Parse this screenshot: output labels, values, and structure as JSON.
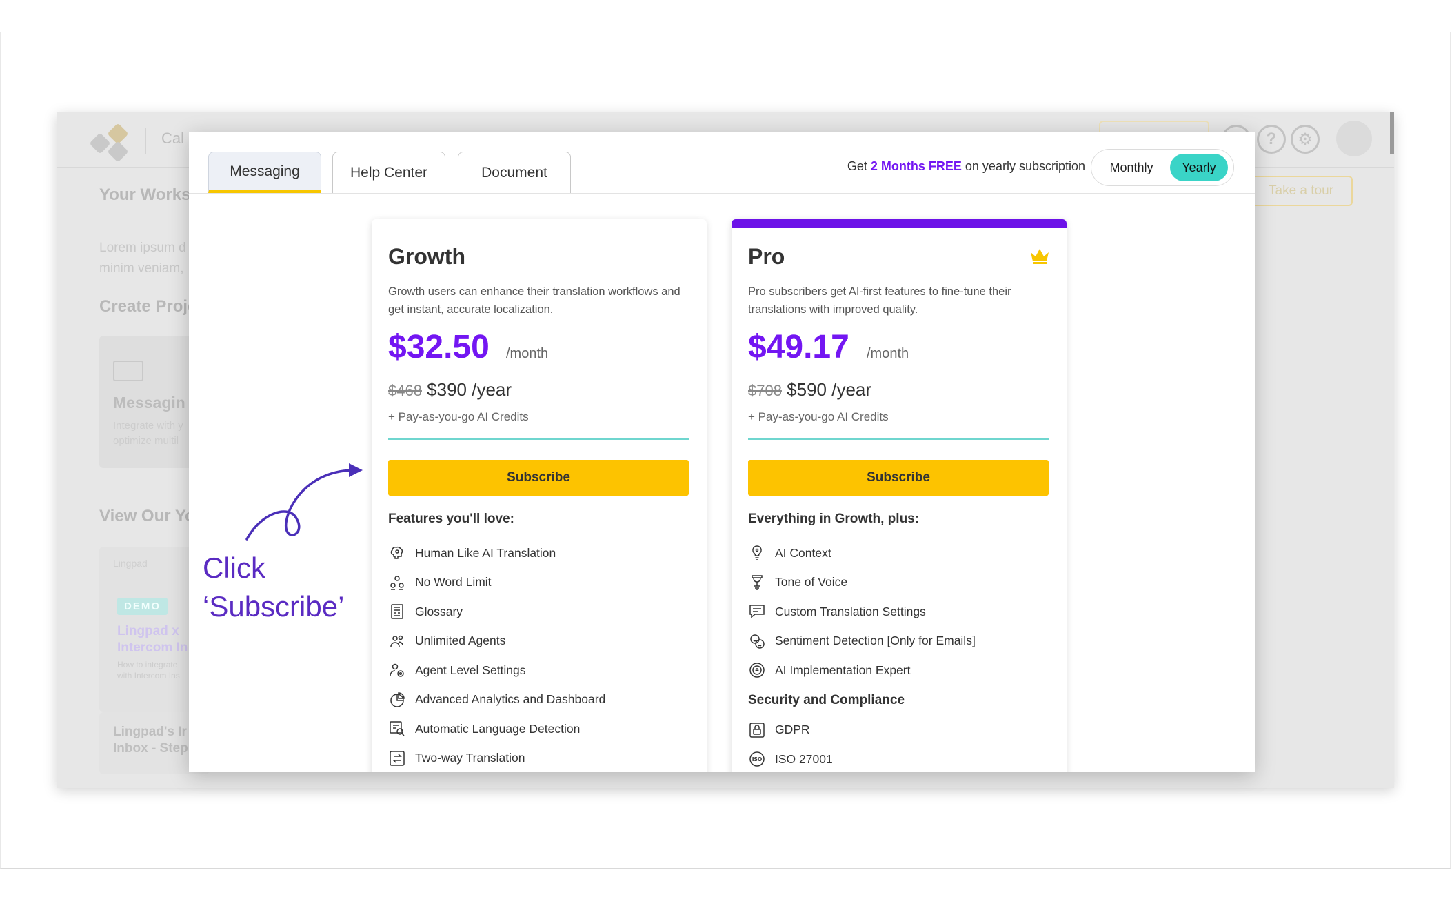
{
  "background_app": {
    "project_label": "Cal",
    "workspace_title": "Your Worksp",
    "intro_line1": "Lorem ipsum d",
    "intro_line2": "minim veniam,",
    "create_projects": "Create Proje",
    "messaging_card_title": "Messagin",
    "messaging_card_line1": "Integrate with y",
    "messaging_card_line2": "optimize multil",
    "view_our": "View Our Yo",
    "demo_brand": "Lingpad",
    "demo_badge": "DEMO",
    "demo_title1": "Lingpad x",
    "demo_title2": "Intercom In",
    "demo_sub1": "How to integrate",
    "demo_sub2": "with Intercom Ins",
    "inbox_line1": "Lingpad's Ir",
    "inbox_line2": "Inbox - Step",
    "take_tour": "Take a tour",
    "help_icon_glyph": "?"
  },
  "modal": {
    "tabs": [
      {
        "label": "Messaging",
        "active": true
      },
      {
        "label": "Help Center",
        "active": false
      },
      {
        "label": "Document",
        "active": false
      }
    ],
    "promo": {
      "prefix": "Get ",
      "highlight": "2 Months FREE",
      "suffix": " on yearly subscription"
    },
    "billing_toggle": {
      "options": [
        "Monthly",
        "Yearly"
      ],
      "selected": "Yearly"
    },
    "plans": [
      {
        "name": "Growth",
        "description": "Growth users can enhance their translation workflows and get instant, accurate localization.",
        "price": "$32.50",
        "per": "/month",
        "old_yearly": "$468",
        "yearly": " $390 /year",
        "credits": "+ Pay-as-you-go AI Credits",
        "cta": "Subscribe",
        "features_title": "Features you'll love:",
        "features": [
          {
            "label": "Human Like AI Translation",
            "icon": "brain-icon"
          },
          {
            "label": "No Word Limit",
            "icon": "infinity-people-icon"
          },
          {
            "label": "Glossary",
            "icon": "glossary-icon"
          },
          {
            "label": "Unlimited Agents",
            "icon": "agents-icon"
          },
          {
            "label": "Agent Level Settings",
            "icon": "agent-settings-icon"
          },
          {
            "label": "Advanced Analytics and Dashboard",
            "icon": "analytics-icon"
          },
          {
            "label": "Automatic Language Detection",
            "icon": "language-detect-icon"
          },
          {
            "label": "Two-way Translation",
            "icon": "two-way-icon"
          }
        ]
      },
      {
        "name": "Pro",
        "description": "Pro subscribers get AI-first features to fine-tune their translations with improved quality.",
        "price": "$49.17",
        "per": "/month",
        "old_yearly": "$708",
        "yearly": " $590 /year",
        "credits": "+ Pay-as-you-go AI Credits",
        "cta": "Subscribe",
        "features_title": "Everything in Growth, plus:",
        "features": [
          {
            "label": "AI Context",
            "icon": "lightbulb-icon"
          },
          {
            "label": "Tone of Voice",
            "icon": "microphone-icon"
          },
          {
            "label": "Custom Translation Settings",
            "icon": "chat-settings-icon"
          },
          {
            "label": "Sentiment Detection [Only for Emails]",
            "icon": "sentiment-icon"
          },
          {
            "label": "AI Implementation Expert",
            "icon": "ai-expert-icon"
          }
        ],
        "security_title": "Security and Compliance",
        "security": [
          {
            "label": "GDPR",
            "icon": "lock-icon"
          },
          {
            "label": "ISO 27001",
            "icon": "iso-icon"
          }
        ]
      }
    ]
  },
  "annotation": {
    "line1": "Click",
    "line2": "‘Subscribe’"
  },
  "colors": {
    "accent_purple": "#7316f2",
    "cta_yellow": "#fdc300",
    "toggle_teal": "#3ad4c7",
    "annotation": "#5a2bc2"
  }
}
